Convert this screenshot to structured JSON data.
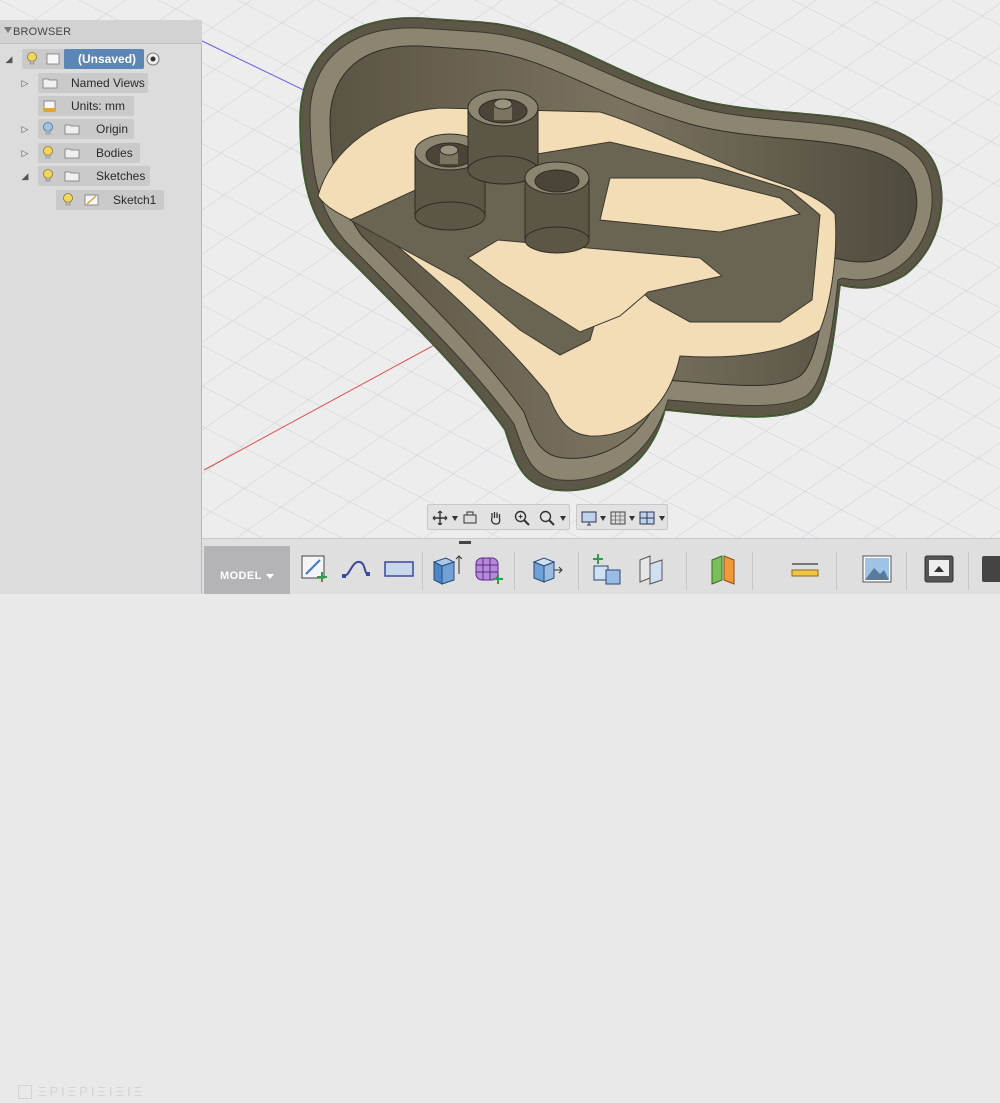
{
  "browser": {
    "title": "BROWSER",
    "root": {
      "label": "(Unsaved)"
    },
    "items": [
      {
        "label": "Named Views"
      },
      {
        "label": "Units: mm"
      },
      {
        "label": "Origin"
      },
      {
        "label": "Bodies"
      },
      {
        "label": "Sketches"
      },
      {
        "label": "Sketch1"
      }
    ],
    "watermark": "ΞΡΙΞΡΙΞΙΞΙΞ"
  },
  "toolbar": {
    "workspace_label": "MODEL",
    "buttons": [
      {
        "name": "create-sketch",
        "icon": "sketch-plus-icon"
      },
      {
        "name": "sketch-curve",
        "icon": "spline-icon"
      },
      {
        "name": "sketch-rectangle",
        "icon": "rectangle-icon"
      },
      {
        "name": "extrude",
        "icon": "extrude-icon"
      },
      {
        "name": "form",
        "icon": "form-cage-icon"
      },
      {
        "name": "modify",
        "icon": "press-pull-icon"
      },
      {
        "name": "assemble",
        "icon": "new-component-icon"
      },
      {
        "name": "construct",
        "icon": "plane-icon"
      },
      {
        "name": "inspect",
        "icon": "section-icon"
      },
      {
        "name": "measure",
        "icon": "measure-icon"
      },
      {
        "name": "insert",
        "icon": "image-icon"
      },
      {
        "name": "make",
        "icon": "3d-print-icon"
      }
    ]
  },
  "colors": {
    "selection": "#5b86b5",
    "body": "#6c6552",
    "face": "#f3ddb6",
    "grid": "#d9d9db",
    "axis_red": "#e25050",
    "axis_blue": "#6262e6"
  }
}
